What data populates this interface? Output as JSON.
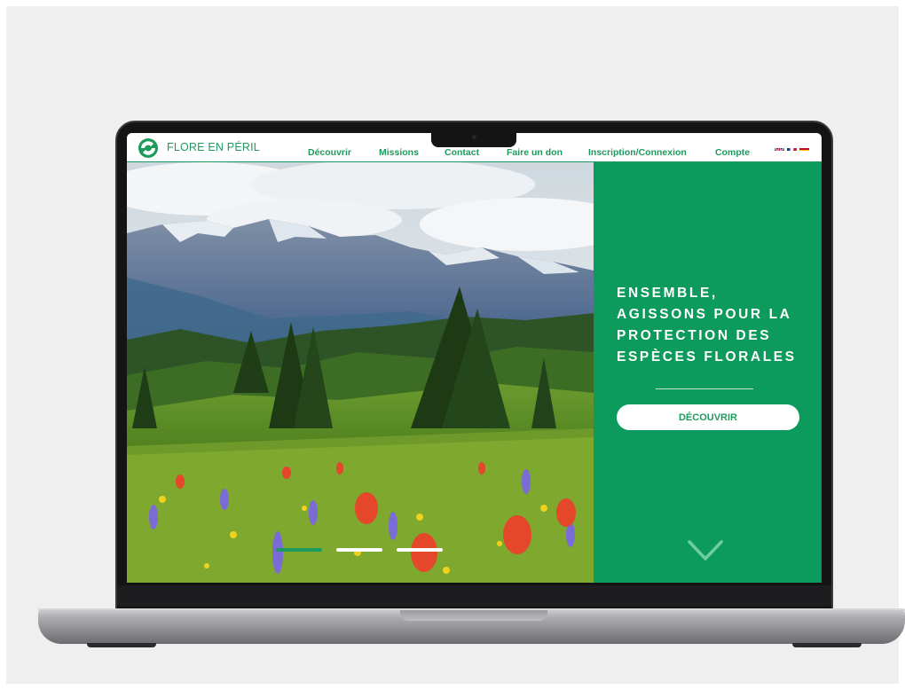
{
  "site": {
    "brand": "FLORE EN PÉRIL",
    "nav": [
      {
        "label": "Découvrir"
      },
      {
        "label": "Missions"
      },
      {
        "label": "Contact"
      },
      {
        "label": "Faire un don"
      },
      {
        "label": "Inscription/Connexion"
      },
      {
        "label": "Compte"
      }
    ],
    "languages": [
      "en",
      "fr",
      "es"
    ]
  },
  "hero": {
    "headline_lines": [
      "ENSEMBLE,",
      "AGISSONS POUR LA",
      "PROTECTION DES",
      "ESPÈCES FLORALES"
    ],
    "cta_label": "DÉCOUVRIR",
    "scroll_icon": "chevron-down-icon",
    "slides_count": 3,
    "active_slide": 1
  },
  "colors": {
    "brand_green": "#1f9a5e",
    "panel_green": "#0d9a5d",
    "white": "#ffffff"
  },
  "icons": {
    "logo": "leaf-globe-logo",
    "flags": [
      "uk-flag-icon",
      "france-flag-icon",
      "spain-flag-icon"
    ]
  }
}
